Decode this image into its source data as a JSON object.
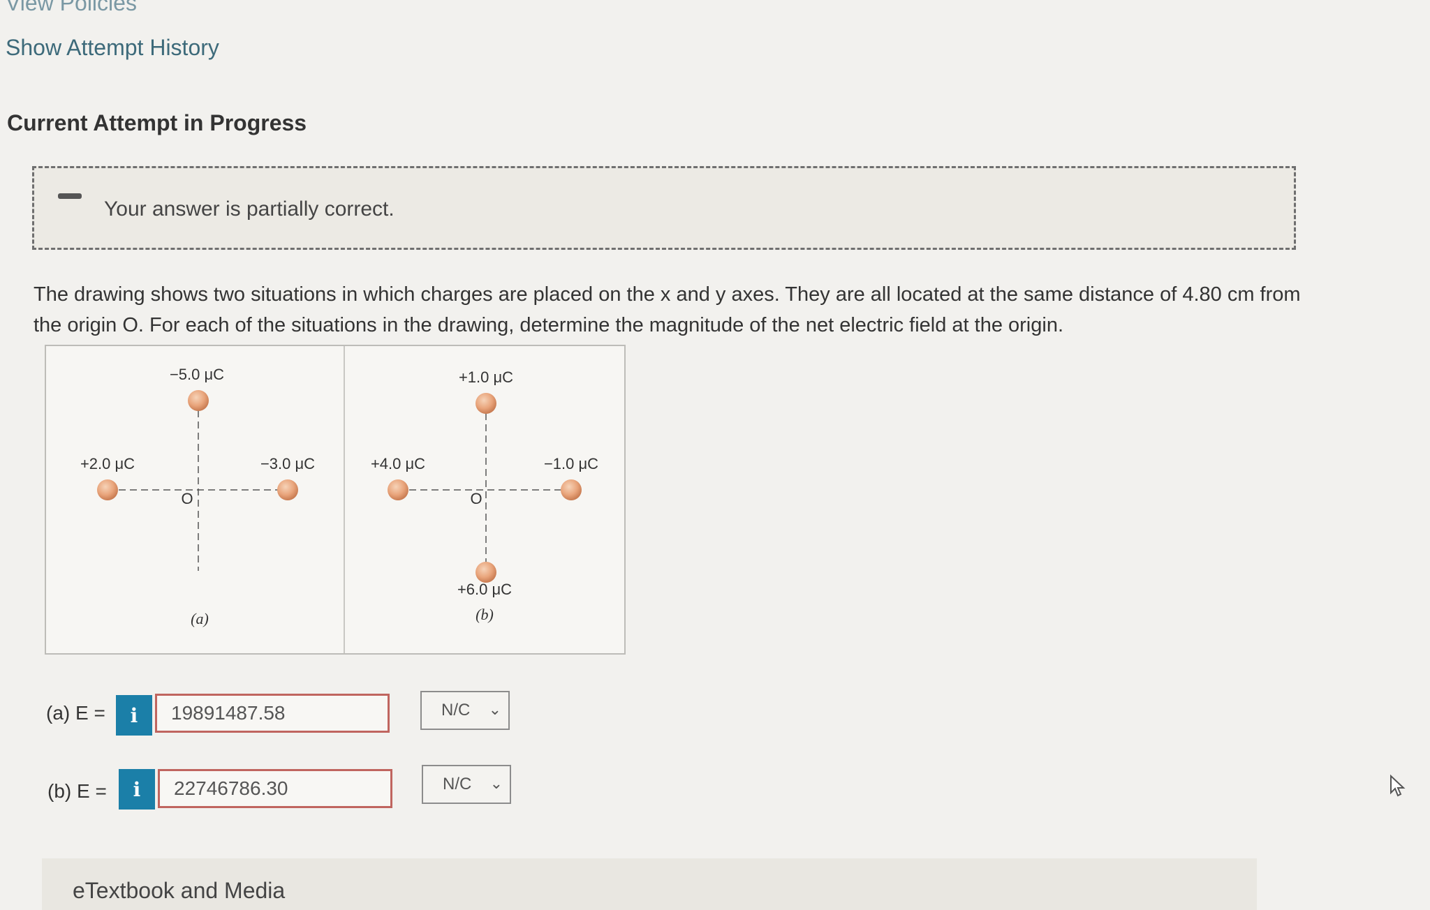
{
  "links": {
    "view_policies": "View Policies",
    "show_history": "Show Attempt History"
  },
  "attempt": {
    "heading": "Current Attempt in Progress"
  },
  "feedback": {
    "text": "Your answer is partially correct.",
    "icon": "minus-icon"
  },
  "question": {
    "text": "The drawing shows two situations in which charges are placed on the x and y axes. They are all located at the same distance of 4.80 cm from the origin O. For each of the situations in the drawing, determine the magnitude of the net electric field at the origin."
  },
  "figure": {
    "origin_label": "O",
    "a": {
      "top": "−5.0 μC",
      "left": "+2.0 μC",
      "right": "−3.0 μC",
      "caption": "(a)"
    },
    "b": {
      "top": "+1.0 μC",
      "left": "+4.0 μC",
      "right": "−1.0 μC",
      "bottom": "+6.0 μC",
      "caption": "(b)"
    }
  },
  "answers": {
    "a": {
      "label": "(a) E =",
      "value": "19891487.58",
      "unit": "N/C"
    },
    "b": {
      "label": "(b) E =",
      "value": "22746786.30",
      "unit": "N/C"
    },
    "info_glyph": "i"
  },
  "footer": {
    "etextbook": "eTextbook and Media"
  },
  "colors": {
    "accent": "#1b7fa8",
    "error_border": "#c0655f",
    "charge": "#e9a57c"
  }
}
